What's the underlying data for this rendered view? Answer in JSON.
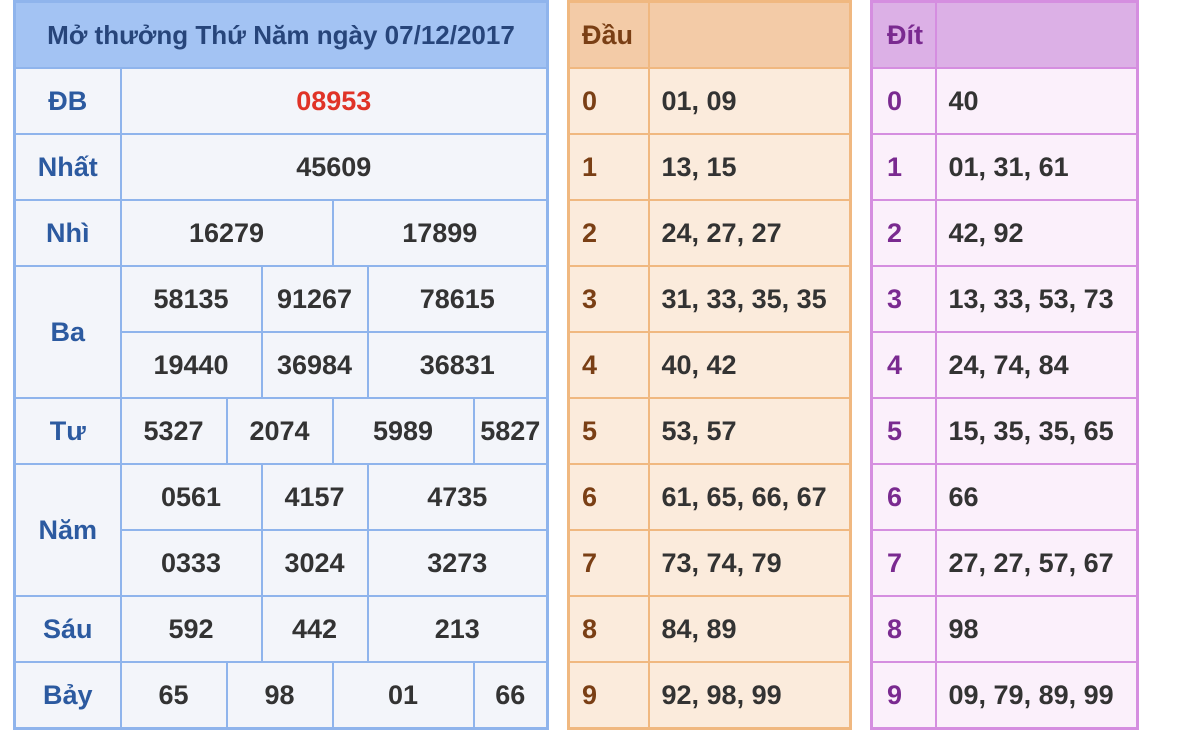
{
  "results": {
    "title": "Mở thưởng Thứ Năm ngày 07/12/2017",
    "db": {
      "label": "ĐB",
      "value": "08953"
    },
    "nhat": {
      "label": "Nhất",
      "value": "45609"
    },
    "nhi": {
      "label": "Nhì",
      "values": [
        "16279",
        "17899"
      ]
    },
    "ba": {
      "label": "Ba",
      "values": [
        "58135",
        "91267",
        "78615",
        "19440",
        "36984",
        "36831"
      ]
    },
    "tu": {
      "label": "Tư",
      "values": [
        "5327",
        "2074",
        "5989",
        "5827"
      ]
    },
    "nam": {
      "label": "Năm",
      "values": [
        "0561",
        "4157",
        "4735",
        "0333",
        "3024",
        "3273"
      ]
    },
    "sau": {
      "label": "Sáu",
      "values": [
        "592",
        "442",
        "213"
      ]
    },
    "bay": {
      "label": "Bảy",
      "values": [
        "65",
        "98",
        "01",
        "66"
      ]
    }
  },
  "dau": {
    "header": "Đầu",
    "rows": [
      {
        "key": "0",
        "val": "01, 09"
      },
      {
        "key": "1",
        "val": "13, 15"
      },
      {
        "key": "2",
        "val": "24, 27, 27"
      },
      {
        "key": "3",
        "val": "31, 33, 35, 35"
      },
      {
        "key": "4",
        "val": "40, 42"
      },
      {
        "key": "5",
        "val": "53, 57"
      },
      {
        "key": "6",
        "val": "61, 65, 66, 67"
      },
      {
        "key": "7",
        "val": "73, 74, 79"
      },
      {
        "key": "8",
        "val": "84, 89"
      },
      {
        "key": "9",
        "val": "92, 98, 99"
      }
    ]
  },
  "dit": {
    "header": "Đít",
    "rows": [
      {
        "key": "0",
        "val": "40"
      },
      {
        "key": "1",
        "val": "01, 31, 61"
      },
      {
        "key": "2",
        "val": "42, 92"
      },
      {
        "key": "3",
        "val": "13, 33, 53, 73"
      },
      {
        "key": "4",
        "val": "24, 74, 84"
      },
      {
        "key": "5",
        "val": "15, 35, 35, 65"
      },
      {
        "key": "6",
        "val": "66"
      },
      {
        "key": "7",
        "val": "27, 27, 57, 67"
      },
      {
        "key": "8",
        "val": "98"
      },
      {
        "key": "9",
        "val": "09, 79, 89, 99"
      }
    ]
  },
  "colors": {
    "results_border": "#8fb4ec",
    "results_header_bg": "#a3c3f3",
    "special_prize": "#e03327",
    "dau_border": "#f0b880",
    "dau_header_bg": "#f3cba7",
    "dit_border": "#d58ee0",
    "dit_header_bg": "#dcb0e6"
  }
}
